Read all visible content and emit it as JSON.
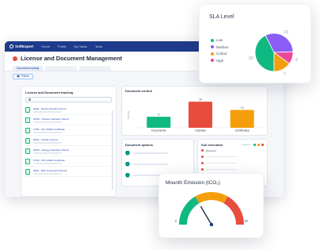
{
  "app": {
    "brand": "SoftExpert",
    "nav": [
      "Home",
      "Portal",
      "My Tasks",
      "Tools"
    ],
    "page_title": "License and Document Management",
    "tabs": [
      "Document tracking"
    ],
    "filter_label": "Filters"
  },
  "left_panel": {
    "title": "License and Document tracking",
    "items": [
      "EA01 - Environmental License",
      "OH01 - Private Operation Permit",
      "CT01 - ISO 45001 Certificate",
      "ES01 - Facility License",
      "OP02 - Energy Operation Permit",
      "CT02 - ISO 14001 Certificate",
      "WI01 - Risk Connection Permit"
    ]
  },
  "document_control": {
    "title": "Document control",
    "ylabel": "Quantity"
  },
  "document_options": {
    "title": "Document options"
  },
  "sub_execution": {
    "title": "Sub execution",
    "status_label": "Progress",
    "status_colors": [
      "#10b981",
      "#f59e0b",
      "#e74c3c"
    ],
    "first_item": "Document"
  },
  "sla": {
    "title": "SLA Level"
  },
  "gauge": {
    "title": "Mounth Emission  (tCO₂)",
    "min_label": "0",
    "max_label": "5k",
    "value_fraction": 0.33,
    "segments": [
      "#10b981",
      "#f59e0b",
      "#e74c3c"
    ]
  },
  "chart_data": [
    {
      "type": "bar",
      "title": "Document control",
      "ylabel": "Quantity",
      "categories": [
        "Documents",
        "Licenses",
        "Certificates"
      ],
      "values": [
        8,
        19,
        13
      ],
      "colors": [
        "#10b981",
        "#e74c3c",
        "#f59e0b"
      ],
      "ylim": [
        0,
        22
      ]
    },
    {
      "type": "pie",
      "title": "SLA Level",
      "categories": [
        "Low",
        "Medium",
        "Critical",
        "High"
      ],
      "values": [
        20,
        15,
        7,
        5
      ],
      "colors": [
        "#10b981",
        "#8b5cf6",
        "#f59e0b",
        "#ec4899"
      ],
      "legend": "left"
    }
  ]
}
